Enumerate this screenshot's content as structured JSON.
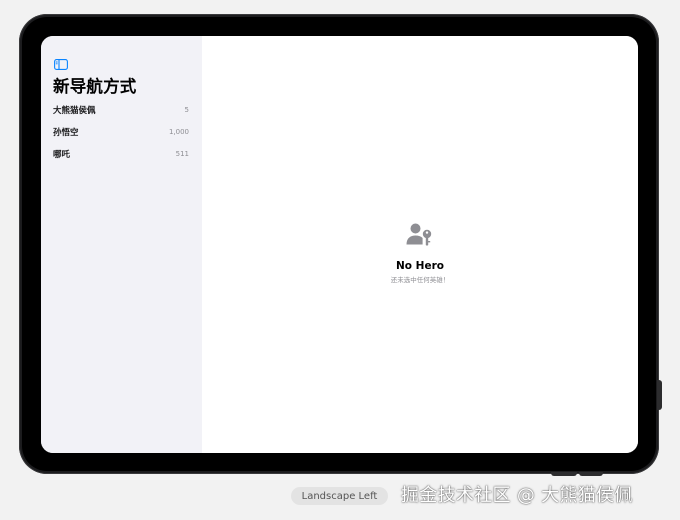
{
  "sidebar": {
    "toggle_icon": "sidebar-left-icon",
    "title": "新导航方式",
    "items": [
      {
        "name": "大熊猫侯佩",
        "count": "5"
      },
      {
        "name": "孙悟空",
        "count": "1,000"
      },
      {
        "name": "哪吒",
        "count": "511"
      }
    ]
  },
  "detail": {
    "empty_icon": "person-key-icon",
    "empty_title": "No Hero",
    "empty_subtitle": "还未选中任何英雄！"
  },
  "device": {
    "orientation_label": "Landscape Left"
  },
  "watermark": "掘金技术社区 @ 大熊猫侯佩",
  "colors": {
    "accent": "#0a84ff",
    "sidebar_bg": "#f2f2f7",
    "secondary_text": "#8e8e93",
    "icon_gray": "#8e8e93"
  }
}
